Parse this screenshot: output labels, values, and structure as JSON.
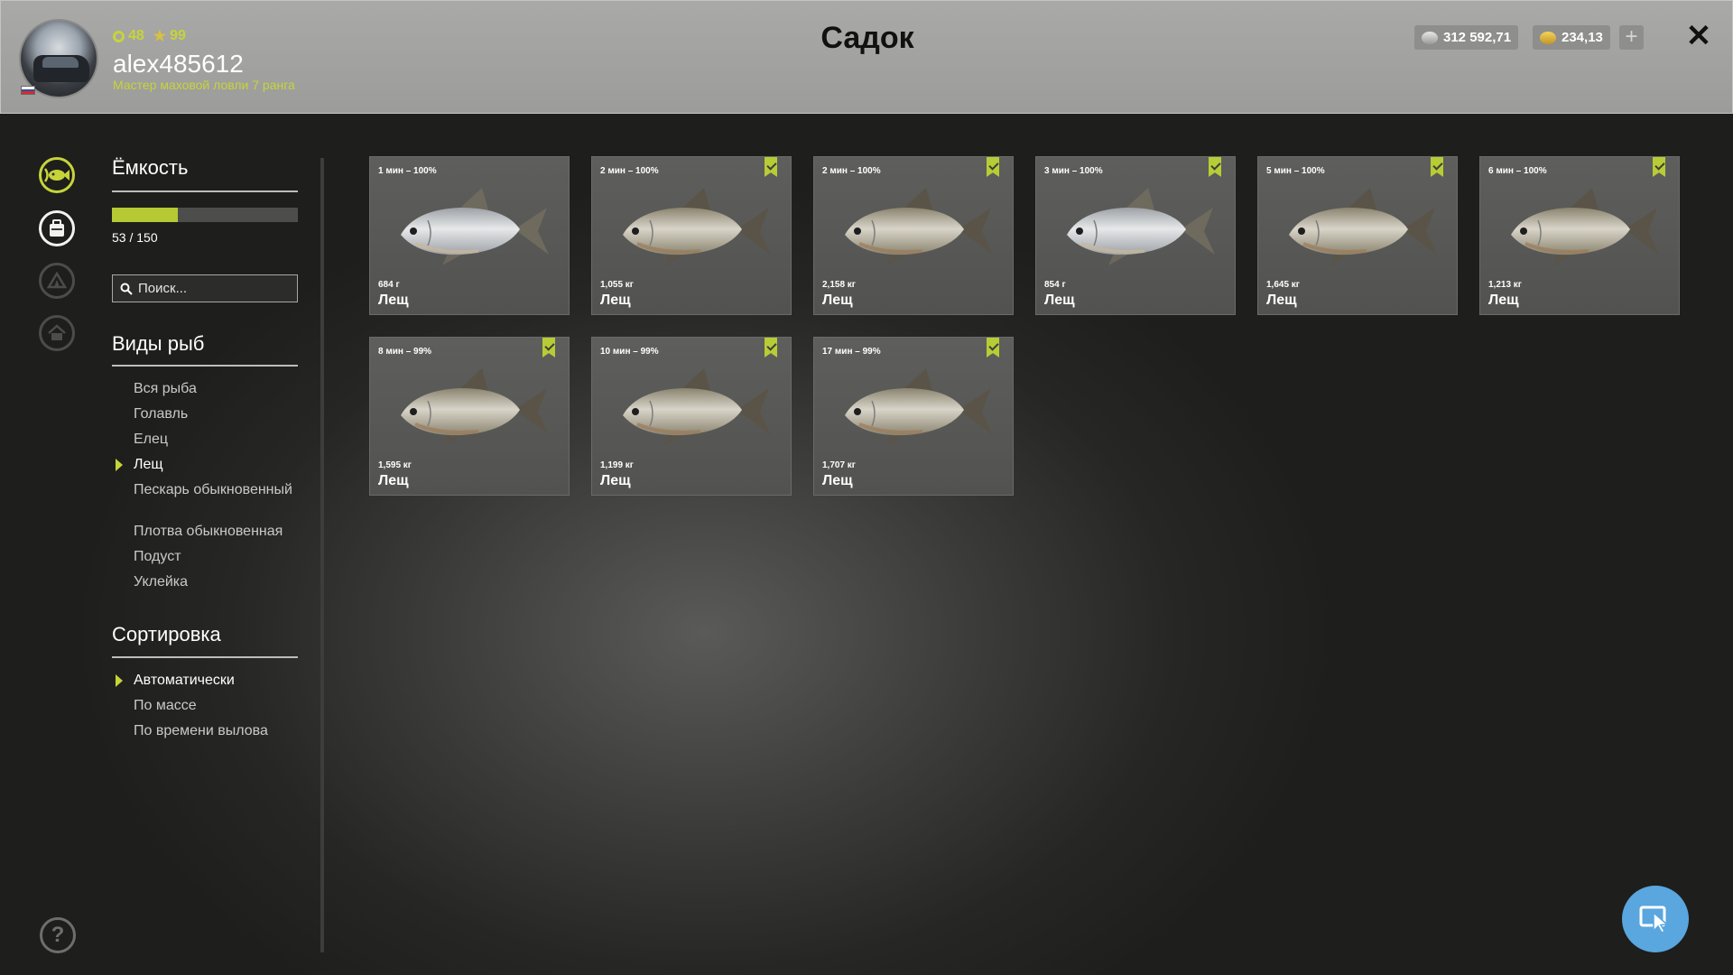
{
  "header": {
    "title": "Садок",
    "username": "alex485612",
    "rank": "Мастер маховой ловли 7 ранга",
    "level": "48",
    "stars": "99",
    "silver": "312 592,71",
    "gold": "234,13",
    "add_label": "+",
    "close_label": "✕"
  },
  "sidebar": {
    "capacity_heading": "Ёмкость",
    "capacity_text": "53 / 150",
    "capacity_fraction": 0.353,
    "search_placeholder": "Поиск...",
    "species_heading": "Виды рыб",
    "species": [
      "Вся рыба",
      "Голавль",
      "Елец",
      "Лещ",
      "Пескарь обыкновенный",
      "Плотва обыкновенная",
      "Подуст",
      "Уклейка"
    ],
    "species_selected": "Лещ",
    "sort_heading": "Сортировка",
    "sort_options": [
      "Автоматически",
      "По массе",
      "По времени вылова"
    ],
    "sort_selected": "Автоматически"
  },
  "fish": [
    {
      "time": "1 мин – 100%",
      "weight": "684 г",
      "name": "Лещ",
      "bookmarked": false,
      "variant": "silver"
    },
    {
      "time": "2 мин – 100%",
      "weight": "1,055 кг",
      "name": "Лещ",
      "bookmarked": true,
      "variant": "bronze"
    },
    {
      "time": "2 мин – 100%",
      "weight": "2,158 кг",
      "name": "Лещ",
      "bookmarked": true,
      "variant": "bronze"
    },
    {
      "time": "3 мин – 100%",
      "weight": "854 г",
      "name": "Лещ",
      "bookmarked": true,
      "variant": "silver"
    },
    {
      "time": "5 мин – 100%",
      "weight": "1,645 кг",
      "name": "Лещ",
      "bookmarked": true,
      "variant": "bronze"
    },
    {
      "time": "6 мин – 100%",
      "weight": "1,213 кг",
      "name": "Лещ",
      "bookmarked": true,
      "variant": "bronze"
    },
    {
      "time": "8 мин – 99%",
      "weight": "1,595 кг",
      "name": "Лещ",
      "bookmarked": true,
      "variant": "bronze"
    },
    {
      "time": "10 мин – 99%",
      "weight": "1,199 кг",
      "name": "Лещ",
      "bookmarked": true,
      "variant": "bronze"
    },
    {
      "time": "17 мин – 99%",
      "weight": "1,707 кг",
      "name": "Лещ",
      "bookmarked": true,
      "variant": "bronze"
    }
  ],
  "colors": {
    "accent": "#c6d43a",
    "bookmark": "#b8cc35",
    "cursor_button": "#5aa6de"
  },
  "help_label": "?"
}
